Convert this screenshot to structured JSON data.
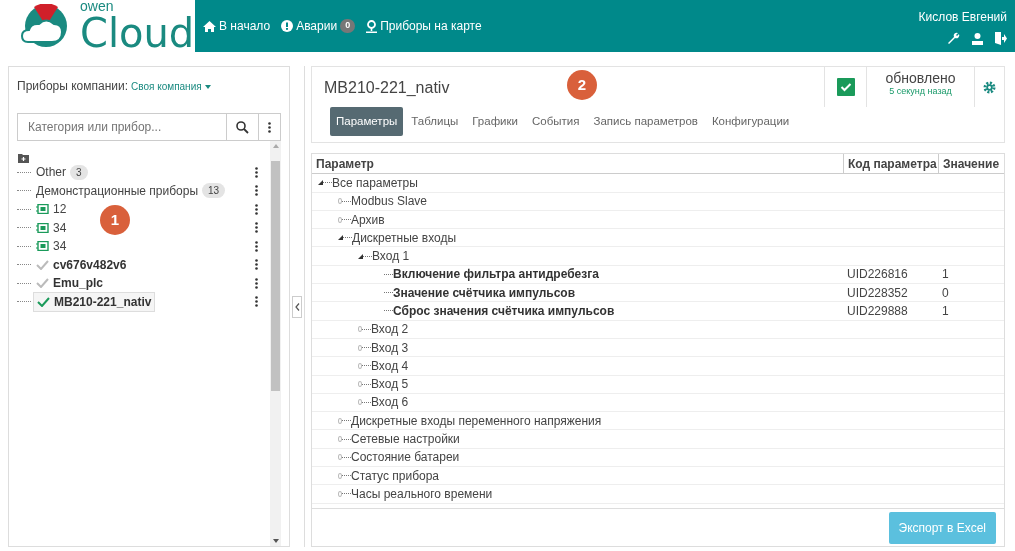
{
  "header": {
    "logo": {
      "small": "owen",
      "large": "Cloud"
    },
    "nav": [
      {
        "label": "В начало"
      },
      {
        "label": "Аварии",
        "badge": "0"
      },
      {
        "label": "Приборы на карте"
      }
    ],
    "user": "Кислов Евгений"
  },
  "sidebar": {
    "label": "Приборы компании:",
    "company": "Своя компания",
    "search": {
      "placeholder": "Категория или прибор..."
    },
    "tree": [
      {
        "label": "Other",
        "count": "3",
        "kind": "group",
        "selected": false
      },
      {
        "label": "Демонстрационные приборы",
        "count": "13",
        "kind": "group",
        "selected": false
      },
      {
        "label": "12",
        "kind": "board",
        "selected": false
      },
      {
        "label": "34",
        "kind": "board",
        "selected": false
      },
      {
        "label": "34",
        "kind": "board",
        "selected": false
      },
      {
        "label": "cv676v482v6",
        "kind": "device",
        "online": false,
        "selected": false
      },
      {
        "label": "Emu_plc",
        "kind": "device",
        "online": false,
        "selected": false
      },
      {
        "label": "MB210-221_nativ",
        "kind": "device",
        "online": true,
        "selected": true
      }
    ]
  },
  "device": {
    "title": "MB210-221_nativ",
    "ok": true,
    "status": "обновлено",
    "updated": "5 секунд назад",
    "tabs": [
      {
        "label": "Параметры",
        "selected": true
      },
      {
        "label": "Таблицы",
        "selected": false
      },
      {
        "label": "Графики",
        "selected": false
      },
      {
        "label": "События",
        "selected": false
      },
      {
        "label": "Запись параметров",
        "selected": false
      },
      {
        "label": "Конфигурации",
        "selected": false
      }
    ],
    "table": {
      "columns": [
        "Параметр",
        "Код параметра",
        "Значение"
      ],
      "rows": [
        {
          "name": "Все параметры",
          "expanded": true,
          "children": [
            {
              "name": "Modbus Slave",
              "expanded": false
            },
            {
              "name": "Архив",
              "expanded": false
            },
            {
              "name": "Дискретные входы",
              "expanded": true,
              "children": [
                {
                  "name": "Вход 1",
                  "expanded": true,
                  "children": [
                    {
                      "name": "Включение фильтра антидребезга",
                      "code": "UID226816",
                      "value": "1"
                    },
                    {
                      "name": "Значение счётчика импульсов",
                      "code": "UID228352",
                      "value": "0"
                    },
                    {
                      "name": "Сброс значения счётчика импульсов",
                      "code": "UID229888",
                      "value": "1"
                    }
                  ]
                },
                {
                  "name": "Вход 2",
                  "expanded": false
                },
                {
                  "name": "Вход 3",
                  "expanded": false
                },
                {
                  "name": "Вход 4",
                  "expanded": false
                },
                {
                  "name": "Вход 5",
                  "expanded": false
                },
                {
                  "name": "Вход 6",
                  "expanded": false
                }
              ]
            },
            {
              "name": "Дискретные входы переменного напряжения",
              "expanded": false
            },
            {
              "name": "Сетевые настройки",
              "expanded": false
            },
            {
              "name": "Состояние батареи",
              "expanded": false
            },
            {
              "name": "Статус прибора",
              "expanded": false
            },
            {
              "name": "Часы реального времени",
              "expanded": false
            }
          ]
        }
      ]
    },
    "export_button": "Экспорт в Excel"
  },
  "callouts": [
    {
      "label": "1"
    },
    {
      "label": "2"
    }
  ]
}
